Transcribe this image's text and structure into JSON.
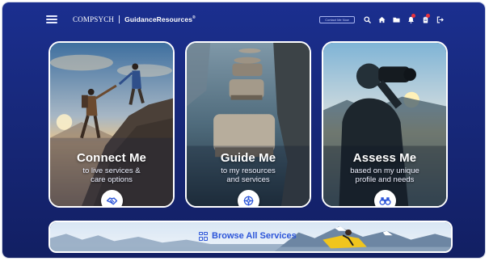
{
  "header": {
    "logo_text": "COMPSYCH",
    "product_name": "GuidanceResources",
    "product_mark": "®",
    "contact_button_label": "Contact Me Now",
    "icons": [
      "search-icon",
      "home-icon",
      "folder-icon",
      "bell-icon",
      "clipboard-icon",
      "logout-icon"
    ]
  },
  "cards": [
    {
      "title": "Connect Me",
      "subtitle_line1": "to live services &",
      "subtitle_line2": "care options",
      "icon": "handshake-icon"
    },
    {
      "title": "Guide Me",
      "subtitle_line1": "to my resources",
      "subtitle_line2": "and services",
      "icon": "compass-icon"
    },
    {
      "title": "Assess Me",
      "subtitle_line1": "based on my unique",
      "subtitle_line2": "profile and needs",
      "icon": "binoculars-icon"
    }
  ],
  "browse": {
    "label": "Browse All Services"
  },
  "colors": {
    "background": "#1b2f8f",
    "accent": "#2c55d9",
    "badge": "#e8323c",
    "card_border": "#ffffff"
  }
}
